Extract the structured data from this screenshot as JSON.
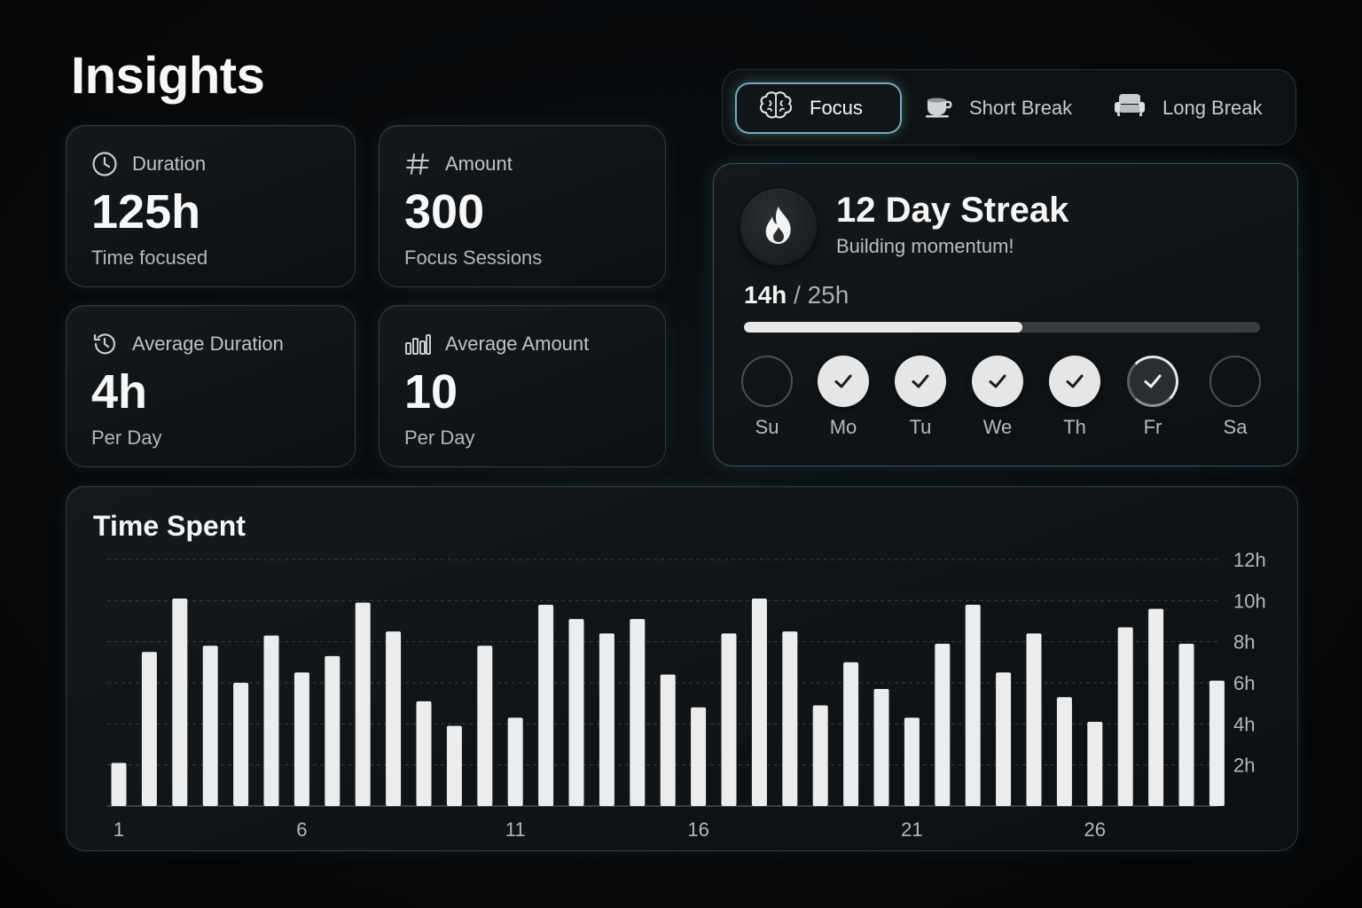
{
  "page": {
    "title": "Insights"
  },
  "stats": [
    {
      "icon": "clock-icon",
      "label": "Duration",
      "value": "125h",
      "sub": "Time focused"
    },
    {
      "icon": "hash-icon",
      "label": "Amount",
      "value": "300",
      "sub": "Focus Sessions"
    },
    {
      "icon": "history-icon",
      "label": "Average Duration",
      "value": "4h",
      "sub": "Per Day"
    },
    {
      "icon": "bar-chart-icon",
      "label": "Average Amount",
      "value": "10",
      "sub": "Per Day"
    }
  ],
  "modes": [
    {
      "icon": "brain-icon",
      "label": "Focus",
      "active": true
    },
    {
      "icon": "coffee-cup-icon",
      "label": "Short Break",
      "active": false
    },
    {
      "icon": "couch-icon",
      "label": "Long Break",
      "active": false
    }
  ],
  "streak": {
    "icon": "flame-icon",
    "title": "12 Day Streak",
    "subtitle": "Building momentum!",
    "current": "14h",
    "separator": "/",
    "target": "25h",
    "progress_fraction": 0.54,
    "days": [
      {
        "label": "Su",
        "state": "empty"
      },
      {
        "label": "Mo",
        "state": "done"
      },
      {
        "label": "Tu",
        "state": "done"
      },
      {
        "label": "We",
        "state": "done"
      },
      {
        "label": "Th",
        "state": "done"
      },
      {
        "label": "Fr",
        "state": "today"
      },
      {
        "label": "Sa",
        "state": "empty"
      }
    ]
  },
  "chart_data": {
    "type": "bar",
    "title": "Time Spent",
    "xlabel": "",
    "ylabel": "",
    "x": [
      1,
      2,
      3,
      4,
      5,
      6,
      7,
      8,
      9,
      10,
      11,
      12,
      13,
      14,
      15,
      16,
      17,
      18,
      19,
      20,
      21,
      22,
      23,
      24,
      25,
      26,
      27,
      28,
      29,
      30,
      31,
      32,
      33,
      34,
      35,
      36,
      37
    ],
    "x_tick_labels": [
      "1",
      "6",
      "11",
      "16",
      "21",
      "26"
    ],
    "x_tick_positions": [
      1,
      7,
      14,
      20,
      27,
      33
    ],
    "values": [
      2.1,
      7.5,
      10.1,
      7.8,
      6.0,
      8.3,
      6.5,
      7.3,
      9.9,
      8.5,
      5.1,
      3.9,
      7.8,
      4.3,
      9.8,
      9.1,
      8.4,
      9.1,
      6.4,
      4.8,
      8.4,
      10.1,
      8.5,
      4.9,
      7.0,
      5.7,
      4.3,
      7.9,
      9.8,
      6.5,
      8.4,
      5.3,
      4.1,
      8.7,
      9.6,
      7.9,
      6.1
    ],
    "y_tick_labels": [
      "2h",
      "4h",
      "6h",
      "8h",
      "10h",
      "12h"
    ],
    "y_ticks": [
      2,
      4,
      6,
      8,
      10,
      12
    ],
    "ylim": [
      0,
      12
    ],
    "grid": true,
    "y_axis_side": "right",
    "bar_color": "#ececec"
  }
}
